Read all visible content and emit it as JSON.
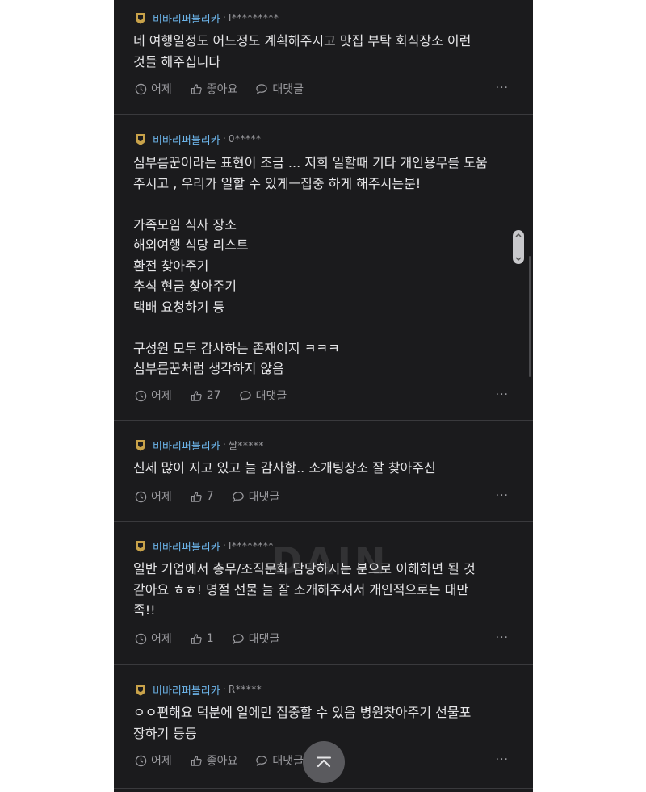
{
  "comments": [
    {
      "company": "비바리퍼블리카",
      "user": "I*********",
      "text": "네 여행일정도 어느정도 계획해주시고 맛집 부탁 회식장소 이런\n것들 해주십니다",
      "time": "어제",
      "likes": "좋아요",
      "reply": "대댓글",
      "more": "···"
    },
    {
      "company": "비바리퍼블리카",
      "user": "0*****",
      "text": "심부름꾼이라는 표현이 조금 ... 저희 일할때 기타 개인용무를 도움\n주시고 , 우리가 일할 수 있게ㅡ집중 하게 해주시는분!\n\n가족모임 식사 장소\n해외여행 식당 리스트\n환전 찾아주기\n추석 현금 찾아주기\n택배 요청하기 등\n\n구성원 모두 감사하는 존재이지 ㅋㅋㅋ\n심부름꾼처럼 생각하지 않음",
      "time": "어제",
      "likes": "27",
      "reply": "대댓글",
      "more": "···"
    },
    {
      "company": "비바리퍼블리카",
      "user": "쌀*****",
      "text": "신세 많이 지고 있고 늘 감사함.. 소개팅장소 잘 찾아주신",
      "time": "어제",
      "likes": "7",
      "reply": "대댓글",
      "more": "···"
    },
    {
      "company": "비바리퍼블리카",
      "user": "I********",
      "text": "일반 기업에서 총무/조직문화 담당하시는 분으로 이해하면 될 것\n같아요 ㅎㅎ! 명절 선물 늘 잘 소개해주셔서 개인적으로는 대만\n족!!",
      "time": "어제",
      "likes": "1",
      "reply": "대댓글",
      "more": "···"
    },
    {
      "company": "비바리퍼블리카",
      "user": "R*****",
      "text": "ㅇㅇ편해요 덕분에 일에만 집중할 수 있음 병원찾아주기 선물포\n장하기 등등",
      "time": "어제",
      "likes": "좋아요",
      "reply": "대댓글",
      "more": "···"
    }
  ],
  "watermark": "DAIN",
  "colors": {
    "background": "#1b1b1d",
    "company": "#6db6ec",
    "text": "#e6e6e8",
    "muted": "#9a9a9e",
    "badge": "#c8a24a"
  }
}
